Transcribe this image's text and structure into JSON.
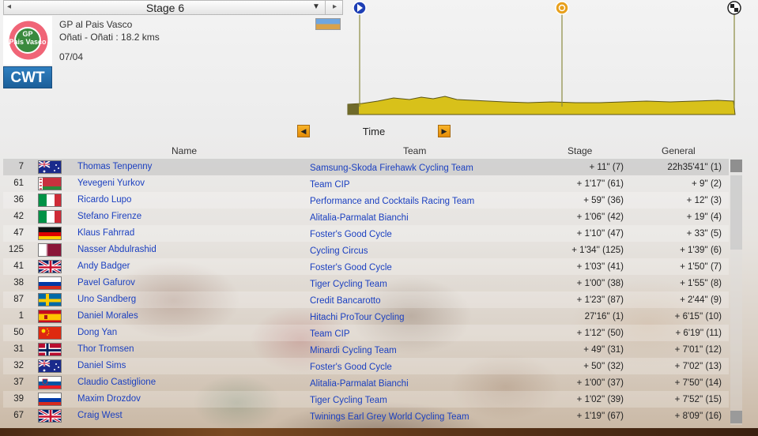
{
  "header": {
    "stage_title": "Stage 6",
    "race_name": "GP al Pais Vasco",
    "route": "Oñati - Oñati : 18.2 kms",
    "date": "07/04",
    "logo_text_line1": "GP",
    "logo_text_line2": "Pais Vasco",
    "badge": "CWT"
  },
  "profile": {
    "markers": [
      "start-icon",
      "intermediate-icon",
      "finish-icon"
    ],
    "colors": {
      "fill": "#d8c11a",
      "outline": "#5a5418",
      "line": "#8a8a40"
    }
  },
  "selector": {
    "label": "Time"
  },
  "columns": {
    "name": "Name",
    "team": "Team",
    "stage": "Stage",
    "general": "General"
  },
  "rows": [
    {
      "num": "7",
      "flag": "australia",
      "name": "Thomas Tenpenny",
      "team": "Samsung-Skoda Firehawk Cycling Team",
      "stage": "+ 11'' (7)",
      "general": "22h35'41'' (1)"
    },
    {
      "num": "61",
      "flag": "belarus",
      "name": "Yevegeni Yurkov",
      "team": "Team CIP",
      "stage": "+ 1'17'' (61)",
      "general": "+ 9'' (2)"
    },
    {
      "num": "36",
      "flag": "italy",
      "name": "Ricardo Lupo",
      "team": "Performance and Cocktails Racing Team",
      "stage": "+ 59'' (36)",
      "general": "+ 12'' (3)"
    },
    {
      "num": "42",
      "flag": "italy",
      "name": "Stefano Firenze",
      "team": "Alitalia-Parmalat Bianchi",
      "stage": "+ 1'06'' (42)",
      "general": "+ 19'' (4)"
    },
    {
      "num": "47",
      "flag": "germany",
      "name": "Klaus Fahrrad",
      "team": "Foster's Good Cycle",
      "stage": "+ 1'10'' (47)",
      "general": "+ 33'' (5)"
    },
    {
      "num": "125",
      "flag": "qatar",
      "name": "Nasser Abdulrashid",
      "team": "Cycling Circus",
      "stage": "+ 1'34'' (125)",
      "general": "+ 1'39'' (6)"
    },
    {
      "num": "41",
      "flag": "uk",
      "name": "Andy Badger",
      "team": "Foster's Good Cycle",
      "stage": "+ 1'03'' (41)",
      "general": "+ 1'50'' (7)"
    },
    {
      "num": "38",
      "flag": "russia",
      "name": "Pavel Gafurov",
      "team": "Tiger Cycling Team",
      "stage": "+ 1'00'' (38)",
      "general": "+ 1'55'' (8)"
    },
    {
      "num": "87",
      "flag": "sweden",
      "name": "Uno Sandberg",
      "team": "Credit Bancarotto",
      "stage": "+ 1'23'' (87)",
      "general": "+ 2'44'' (9)"
    },
    {
      "num": "1",
      "flag": "spain",
      "name": "Daniel Morales",
      "team": "Hitachi ProTour Cycling",
      "stage": "27'16'' (1)",
      "general": "+ 6'15'' (10)"
    },
    {
      "num": "50",
      "flag": "china",
      "name": "Dong Yan",
      "team": "Team CIP",
      "stage": "+ 1'12'' (50)",
      "general": "+ 6'19'' (11)"
    },
    {
      "num": "31",
      "flag": "norway",
      "name": "Thor Tromsen",
      "team": "Minardi Cycling Team",
      "stage": "+ 49'' (31)",
      "general": "+ 7'01'' (12)"
    },
    {
      "num": "32",
      "flag": "australia",
      "name": "Daniel Sims",
      "team": "Foster's Good Cycle",
      "stage": "+ 50'' (32)",
      "general": "+ 7'02'' (13)"
    },
    {
      "num": "37",
      "flag": "slovenia",
      "name": "Claudio Castiglione",
      "team": "Alitalia-Parmalat Bianchi",
      "stage": "+ 1'00'' (37)",
      "general": "+ 7'50'' (14)"
    },
    {
      "num": "39",
      "flag": "russia",
      "name": "Maxim Drozdov",
      "team": "Tiger Cycling Team",
      "stage": "+ 1'02'' (39)",
      "general": "+ 7'52'' (15)"
    },
    {
      "num": "67",
      "flag": "uk",
      "name": "Craig West",
      "team": "Twinings Earl Grey World Cycling Team",
      "stage": "+ 1'19'' (67)",
      "general": "+ 8'09'' (16)"
    }
  ]
}
